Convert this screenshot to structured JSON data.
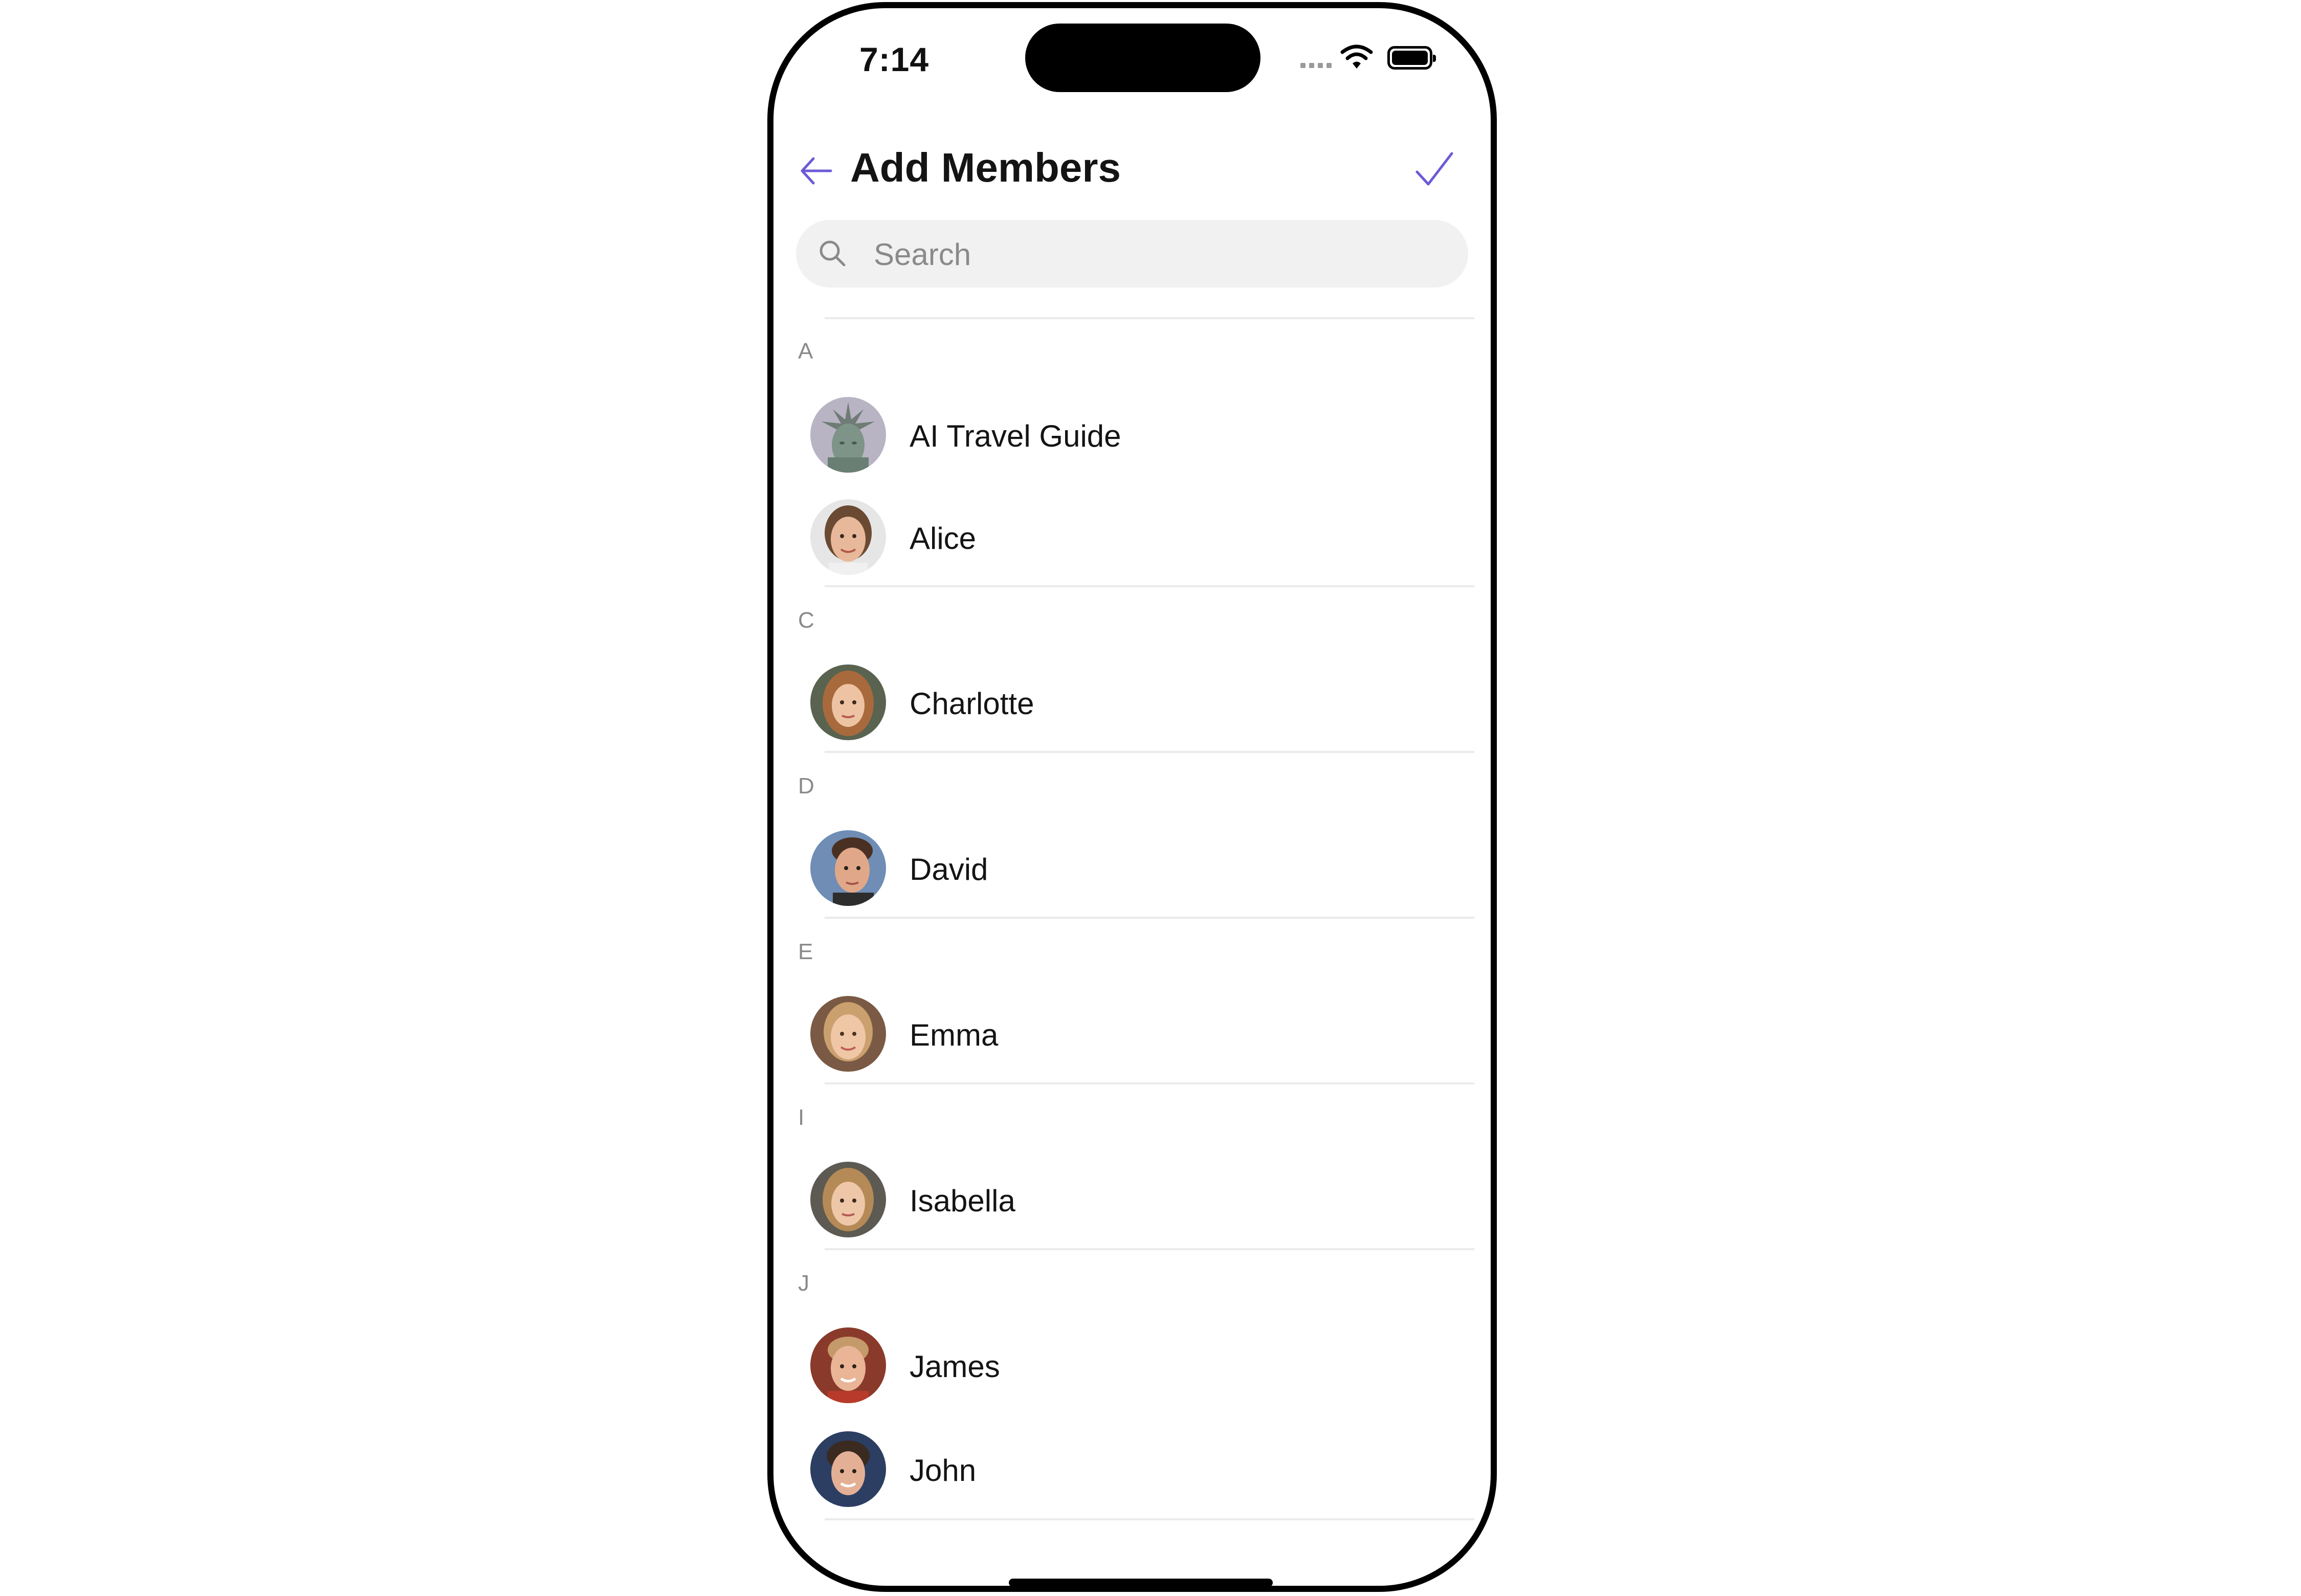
{
  "status_bar": {
    "time": "7:14"
  },
  "header": {
    "title": "Add Members"
  },
  "search": {
    "placeholder": "Search",
    "value": ""
  },
  "sections": [
    {
      "letter": "A",
      "members": [
        {
          "name": "AI Travel Guide",
          "avatar": "statue-of-liberty"
        },
        {
          "name": "Alice",
          "avatar": "woman-face"
        }
      ]
    },
    {
      "letter": "C",
      "members": [
        {
          "name": "Charlotte",
          "avatar": "woman-face"
        }
      ]
    },
    {
      "letter": "D",
      "members": [
        {
          "name": "David",
          "avatar": "man-face"
        }
      ]
    },
    {
      "letter": "E",
      "members": [
        {
          "name": "Emma",
          "avatar": "woman-face"
        }
      ]
    },
    {
      "letter": "I",
      "members": [
        {
          "name": "Isabella",
          "avatar": "woman-face"
        }
      ]
    },
    {
      "letter": "J",
      "members": [
        {
          "name": "James",
          "avatar": "man-face"
        },
        {
          "name": "John",
          "avatar": "man-face"
        }
      ]
    }
  ],
  "colors": {
    "accent": "#6a5ad7",
    "section_label": "#8a8a8a",
    "search_bg": "#f1f1f1"
  }
}
